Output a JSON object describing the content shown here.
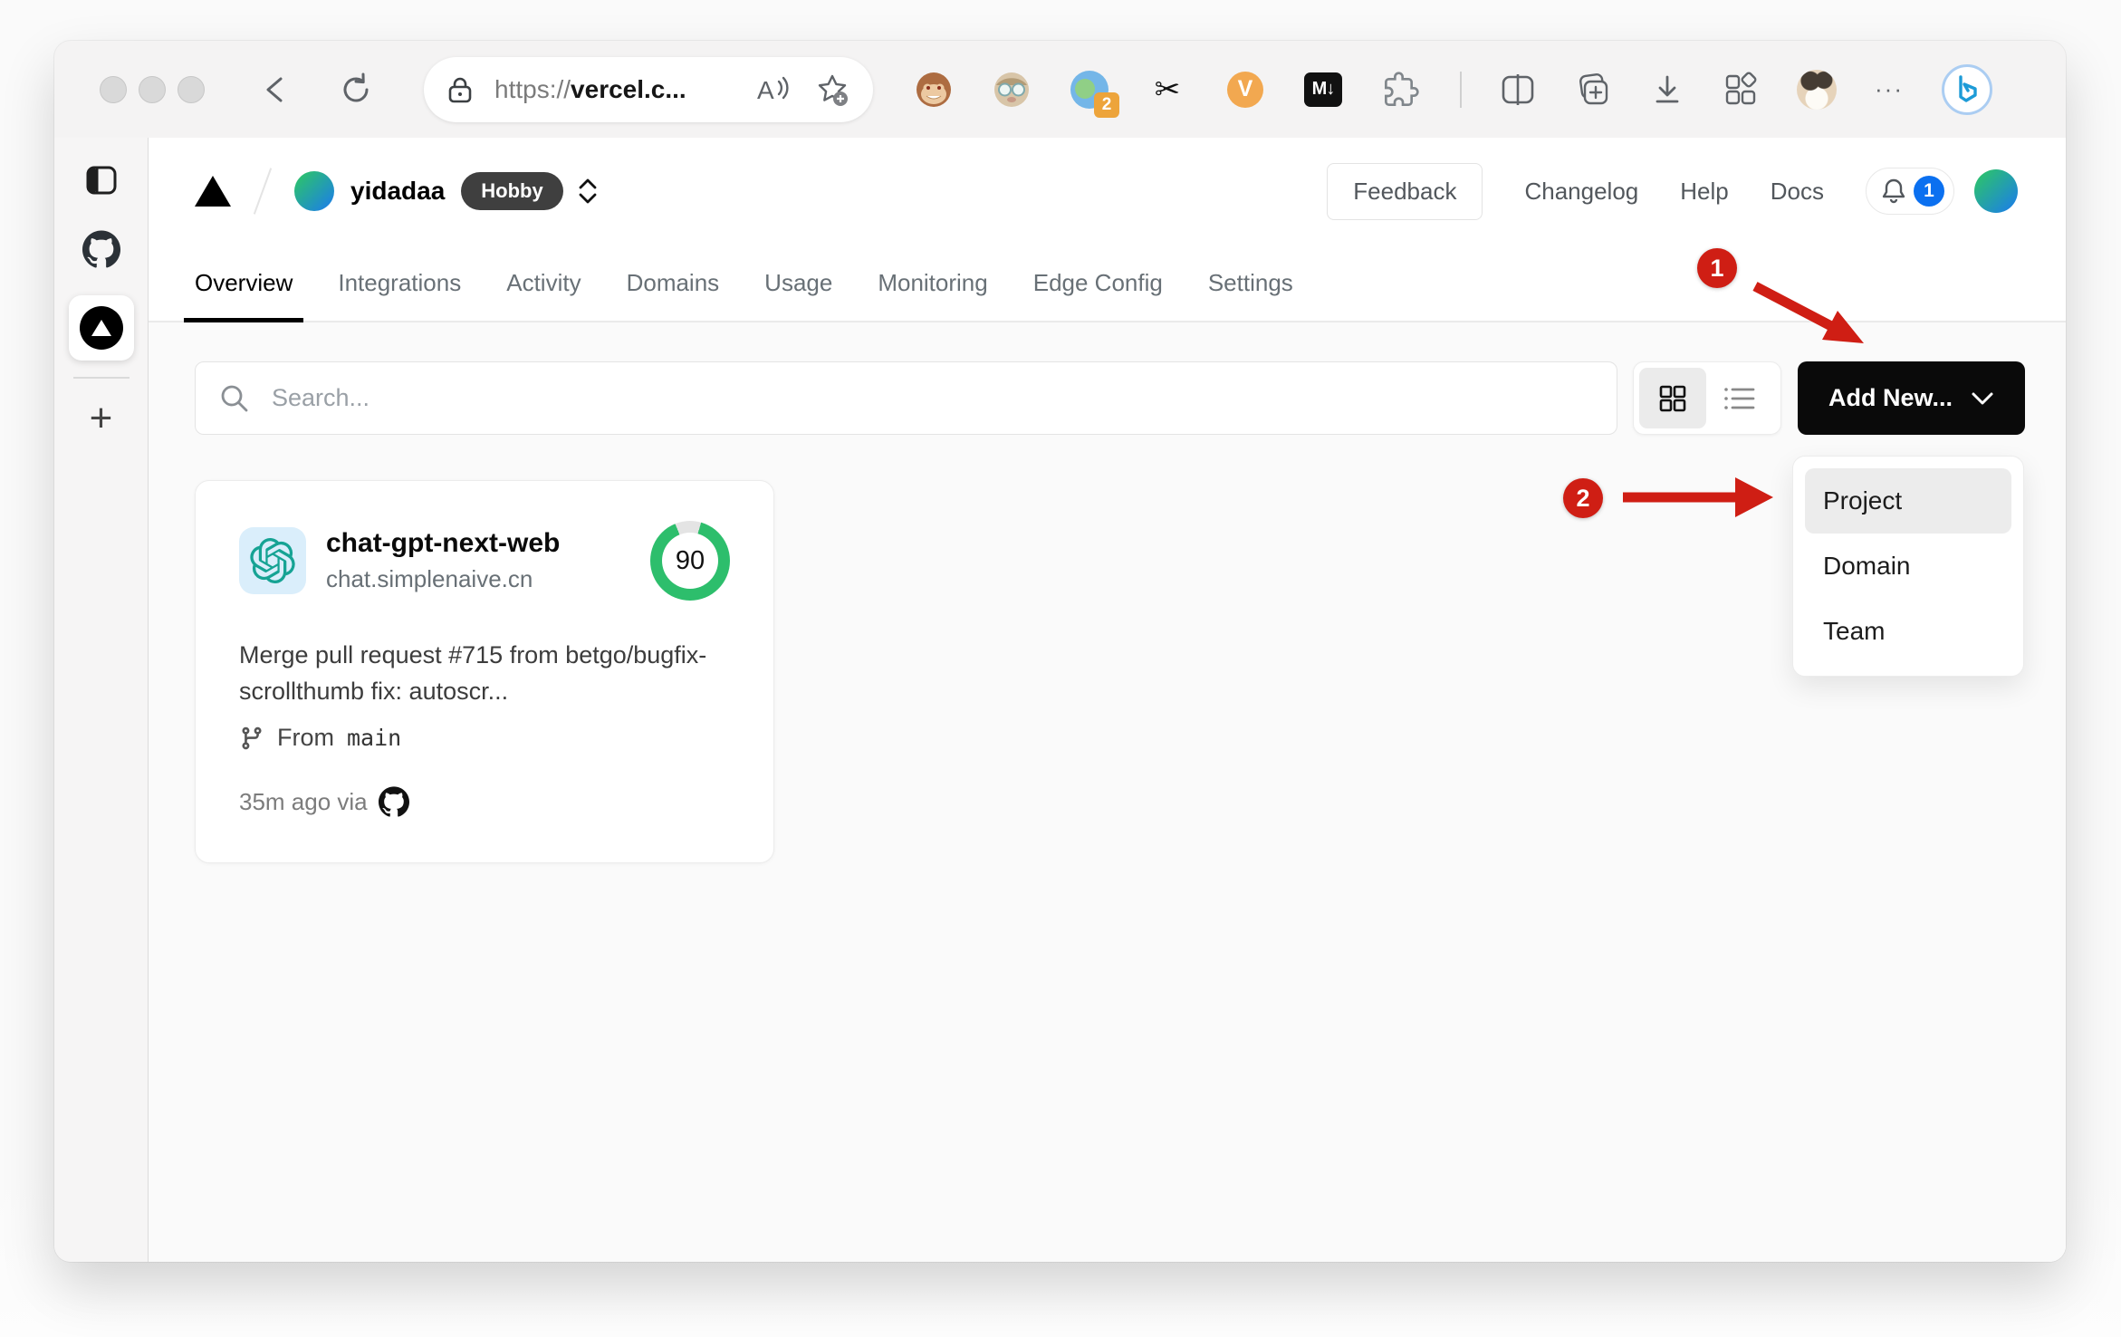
{
  "browser": {
    "url_scheme": "https://",
    "url_host": "vercel.c...",
    "ext_badge_count": "2",
    "scissors_glyph": "✂",
    "v_ext_label": "V",
    "markdown_ext_label": "M↓",
    "more_glyph": "···",
    "new_tab_glyph": "+"
  },
  "header": {
    "team_name": "yidadaa",
    "plan_badge": "Hobby",
    "feedback_label": "Feedback",
    "changelog_label": "Changelog",
    "help_label": "Help",
    "docs_label": "Docs",
    "notification_count": "1"
  },
  "tabs": [
    {
      "label": "Overview"
    },
    {
      "label": "Integrations"
    },
    {
      "label": "Activity"
    },
    {
      "label": "Domains"
    },
    {
      "label": "Usage"
    },
    {
      "label": "Monitoring"
    },
    {
      "label": "Edge Config"
    },
    {
      "label": "Settings"
    }
  ],
  "controls": {
    "search_placeholder": "Search...",
    "add_new_label": "Add New..."
  },
  "project_card": {
    "name": "chat-gpt-next-web",
    "domain": "chat.simplenaive.cn",
    "score": "90",
    "commit_message": "Merge pull request #715 from betgo/bugfix-scrollthumb fix: autoscr...",
    "from_label": "From",
    "branch": "main",
    "deployed": "35m ago via"
  },
  "dropdown": {
    "items": [
      {
        "label": "Project"
      },
      {
        "label": "Domain"
      },
      {
        "label": "Team"
      }
    ]
  },
  "annotations": {
    "step1": "1",
    "step2": "2"
  },
  "colors": {
    "annotation_red": "#cf1e14",
    "score_green": "#2dbe6c",
    "notification_blue": "#0b70f0",
    "button_black": "#0a0a0a"
  }
}
